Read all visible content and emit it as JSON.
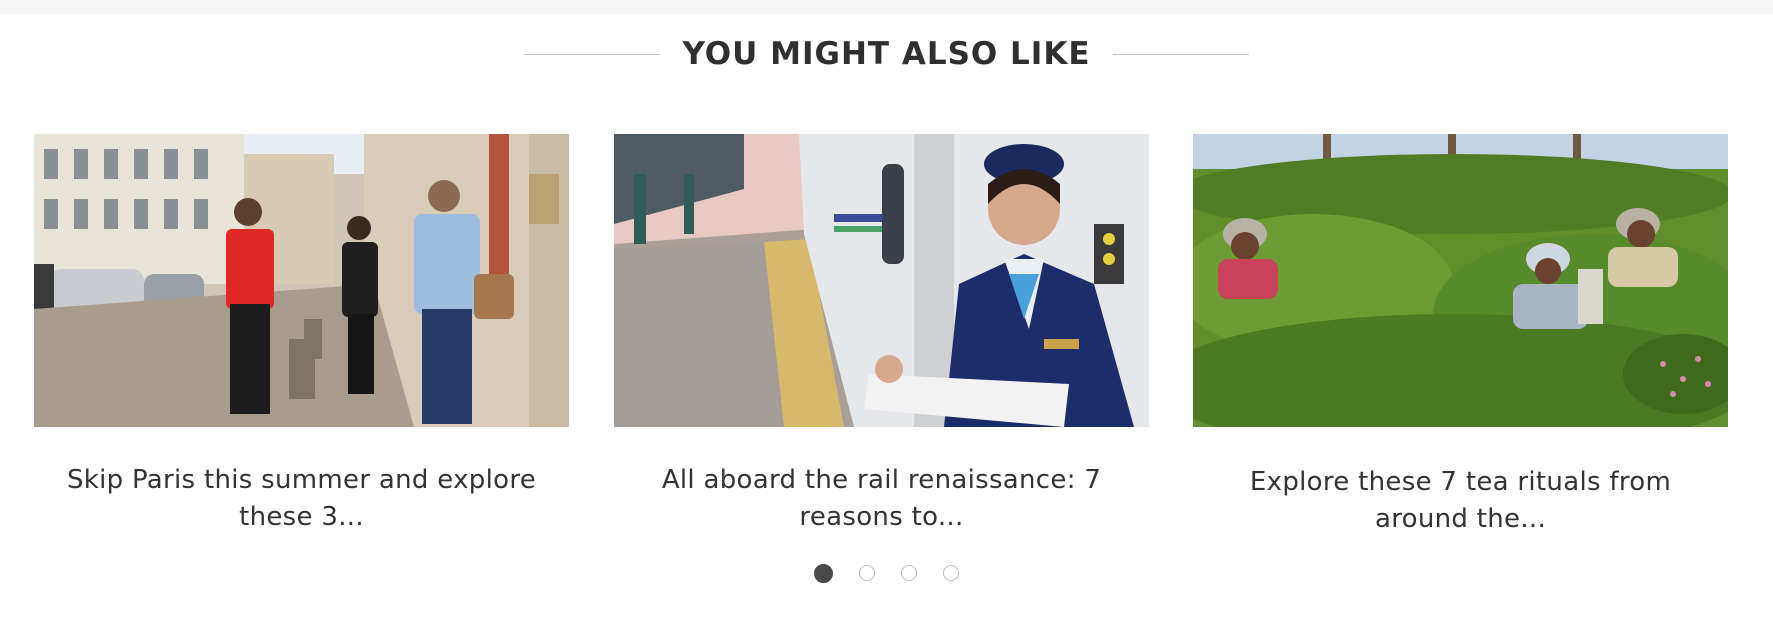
{
  "section": {
    "title": "YOU MIGHT ALSO LIKE"
  },
  "cards": [
    {
      "caption": "Skip Paris this summer and explore these 3...",
      "image": "paris-street-walking-tour-photo"
    },
    {
      "caption": "All aboard the rail renaissance: 7 reasons to...",
      "image": "train-attendant-platform-photo"
    },
    {
      "caption": "Explore these 7 tea rituals from around the...",
      "image": "tea-plantation-pickers-photo"
    }
  ],
  "carousel": {
    "pages": 4,
    "active_index": 0
  },
  "colors": {
    "title": "#2f2f2f",
    "dot_active": "#4a4a4a",
    "dot_inactive_border": "#bdbdbd"
  }
}
